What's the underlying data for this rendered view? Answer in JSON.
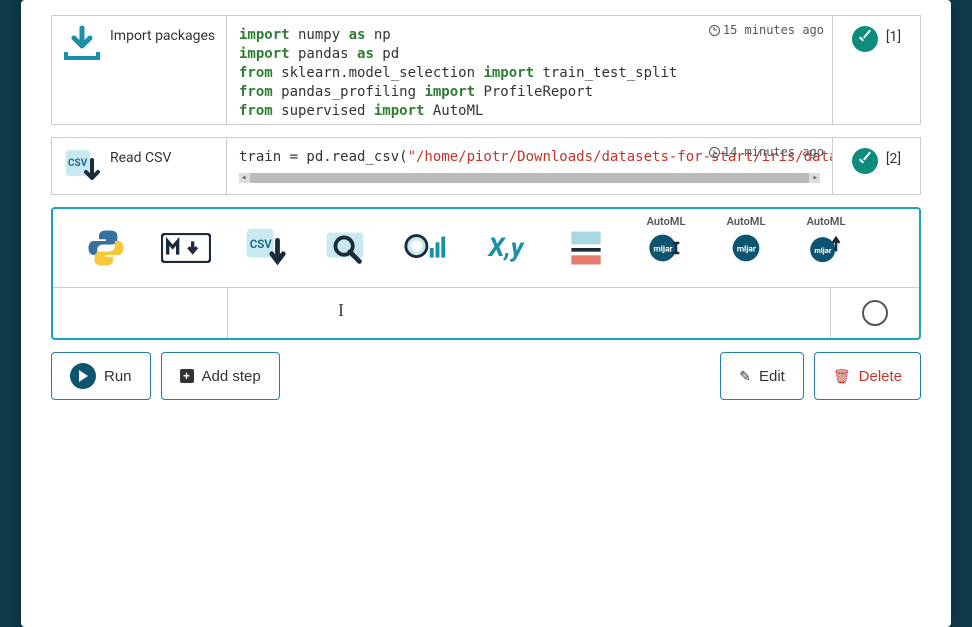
{
  "cells": [
    {
      "label": "Import packages",
      "timestamp": "15 minutes ago",
      "exec_count": "[1]",
      "code": {
        "l1_kw1": "import",
        "l1_rest": " numpy ",
        "l1_kw2": "as",
        "l1_rest2": " np",
        "l2_kw1": "import",
        "l2_rest": " pandas ",
        "l2_kw2": "as",
        "l2_rest2": " pd",
        "l3_kw1": "from",
        "l3_rest": " sklearn.model_selection ",
        "l3_kw2": "import",
        "l3_rest2": " train_test_split",
        "l4_kw1": "from",
        "l4_rest": " pandas_profiling ",
        "l4_kw2": "import",
        "l4_rest2": " ProfileReport",
        "l5_kw1": "from",
        "l5_rest": " supervised ",
        "l5_kw2": "import",
        "l5_rest2": " AutoML"
      }
    },
    {
      "label": "Read CSV",
      "timestamp": "14 minutes ago",
      "exec_count": "[2]",
      "code_plain_pre": "train = pd.read_csv(",
      "code_str": "\"/home/piotr/Downloads/datasets-for-start/iris/data.csv\""
    }
  ],
  "toolstrip": {
    "automl_label": "AutoML",
    "icons": [
      "python",
      "markdown",
      "read-csv",
      "explore",
      "profile",
      "xy",
      "split",
      "automl-train",
      "automl-predict",
      "automl-export"
    ]
  },
  "actions": {
    "run": "Run",
    "add_step": "Add step",
    "edit": "Edit",
    "delete": "Delete"
  }
}
